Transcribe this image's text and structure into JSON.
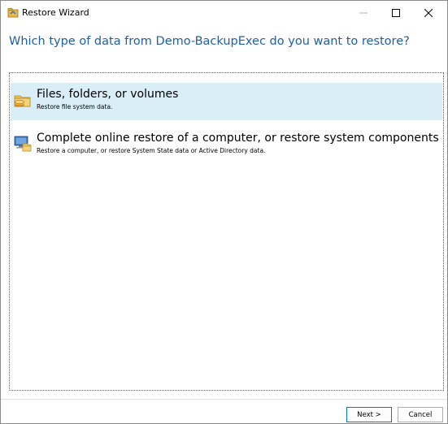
{
  "window": {
    "title": "Restore Wizard",
    "icon": "restore-wizard-icon"
  },
  "heading": "Which type of data from Demo-BackupExec do you want to restore?",
  "options": [
    {
      "title": "Files, folders, or volumes",
      "description": "Restore file system data.",
      "icon": "folder-drive-icon",
      "selected": true
    },
    {
      "title": "Complete online restore of a computer, or restore system components",
      "description": "Restore a computer, or restore System State data or Active Directory data.",
      "icon": "computer-restore-icon",
      "selected": false
    }
  ],
  "buttons": {
    "next": "Next >",
    "cancel": "Cancel"
  },
  "colors": {
    "heading": "#1e5fa6",
    "selection": "#daeef7",
    "focus_border": "#0078d7"
  }
}
